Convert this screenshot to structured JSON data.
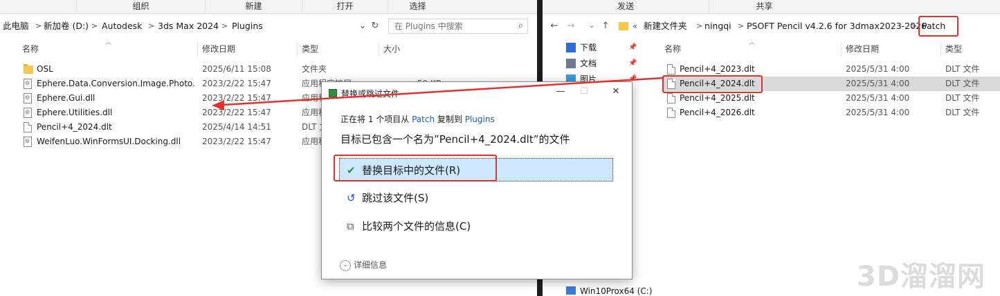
{
  "left": {
    "ribbon": [
      "组织",
      "新建",
      "打开",
      "选择"
    ],
    "breadcrumb": [
      "此电脑",
      "新加卷 (D:)",
      "Autodesk",
      "3ds Max 2024",
      "Plugins"
    ],
    "search_placeholder": "在 Plugins 中搜索",
    "columns": {
      "name": "名称",
      "date": "修改日期",
      "type": "类型",
      "size": "大小"
    },
    "files": [
      {
        "name": "OSL",
        "date": "2025/6/11 15:08",
        "type": "文件夹",
        "size": "",
        "icon": "folder-icon"
      },
      {
        "name": "Ephere.Data.Conversion.Image.Photo...",
        "date": "2023/2/22 15:47",
        "type": "应用程序扩展",
        "size": "59 KB",
        "icon": "dll-icon"
      },
      {
        "name": "Ephere.Gui.dll",
        "date": "2023/2/22 15:47",
        "type": "应用程序扩展",
        "size": "",
        "icon": "dll-icon"
      },
      {
        "name": "Ephere.Utilities.dll",
        "date": "2023/2/22 15:47",
        "type": "应用程序扩展",
        "size": "",
        "icon": "dll-icon"
      },
      {
        "name": "Pencil+4_2024.dlt",
        "date": "2025/4/14 14:51",
        "type": "DLT 文件",
        "size": "",
        "icon": "doc-icon"
      },
      {
        "name": "WeifenLuo.WinFormsUI.Docking.dll",
        "date": "2023/2/22 15:47",
        "type": "应用程序扩展",
        "size": "",
        "icon": "dll-icon"
      }
    ]
  },
  "right": {
    "ribbon": [
      "发送",
      "共享"
    ],
    "breadcrumb": [
      "新建文件夹",
      "ningqi",
      "PSOFT Pencil v4.2.6 for 3dmax2023-2026",
      "Patch"
    ],
    "nav": [
      {
        "label": "下载",
        "icon": "download-icon"
      },
      {
        "label": "文档",
        "icon": "documents-icon"
      },
      {
        "label": "图片",
        "icon": "pictures-icon"
      }
    ],
    "nav_bottom": "Win10Prox64 (C:)",
    "columns": {
      "name": "名称",
      "date": "修改日期",
      "type": "类型"
    },
    "files": [
      {
        "name": "Pencil+4_2023.dlt",
        "date": "2025/5/31 4:00",
        "type": "DLT 文件"
      },
      {
        "name": "Pencil+4_2024.dlt",
        "date": "2025/5/31 4:00",
        "type": "DLT 文件"
      },
      {
        "name": "Pencil+4_2025.dlt",
        "date": "2025/5/31 4:00",
        "type": "DLT 文件"
      },
      {
        "name": "Pencil+4_2026.dlt",
        "date": "2025/5/31 4:00",
        "type": "DLT 文件"
      }
    ]
  },
  "dialog": {
    "title": "替换或跳过文件",
    "sub_prefix": "正在将 1 个项目从",
    "sub_from": "Patch",
    "sub_mid": "复制到",
    "sub_to": "Plugins",
    "main": "目标已包含一个名为”Pencil+4_2024.dlt”的文件",
    "opt_replace": "替换目标中的文件(R)",
    "opt_skip": "跳过该文件(S)",
    "opt_compare": "比较两个文件的信息(C)",
    "details": "详细信息"
  },
  "watermark": "3D溜溜网",
  "colors": {
    "annotation_red": "#e0322d",
    "selection_blue": "#cde8ff",
    "link_blue": "#1a5fb4"
  }
}
